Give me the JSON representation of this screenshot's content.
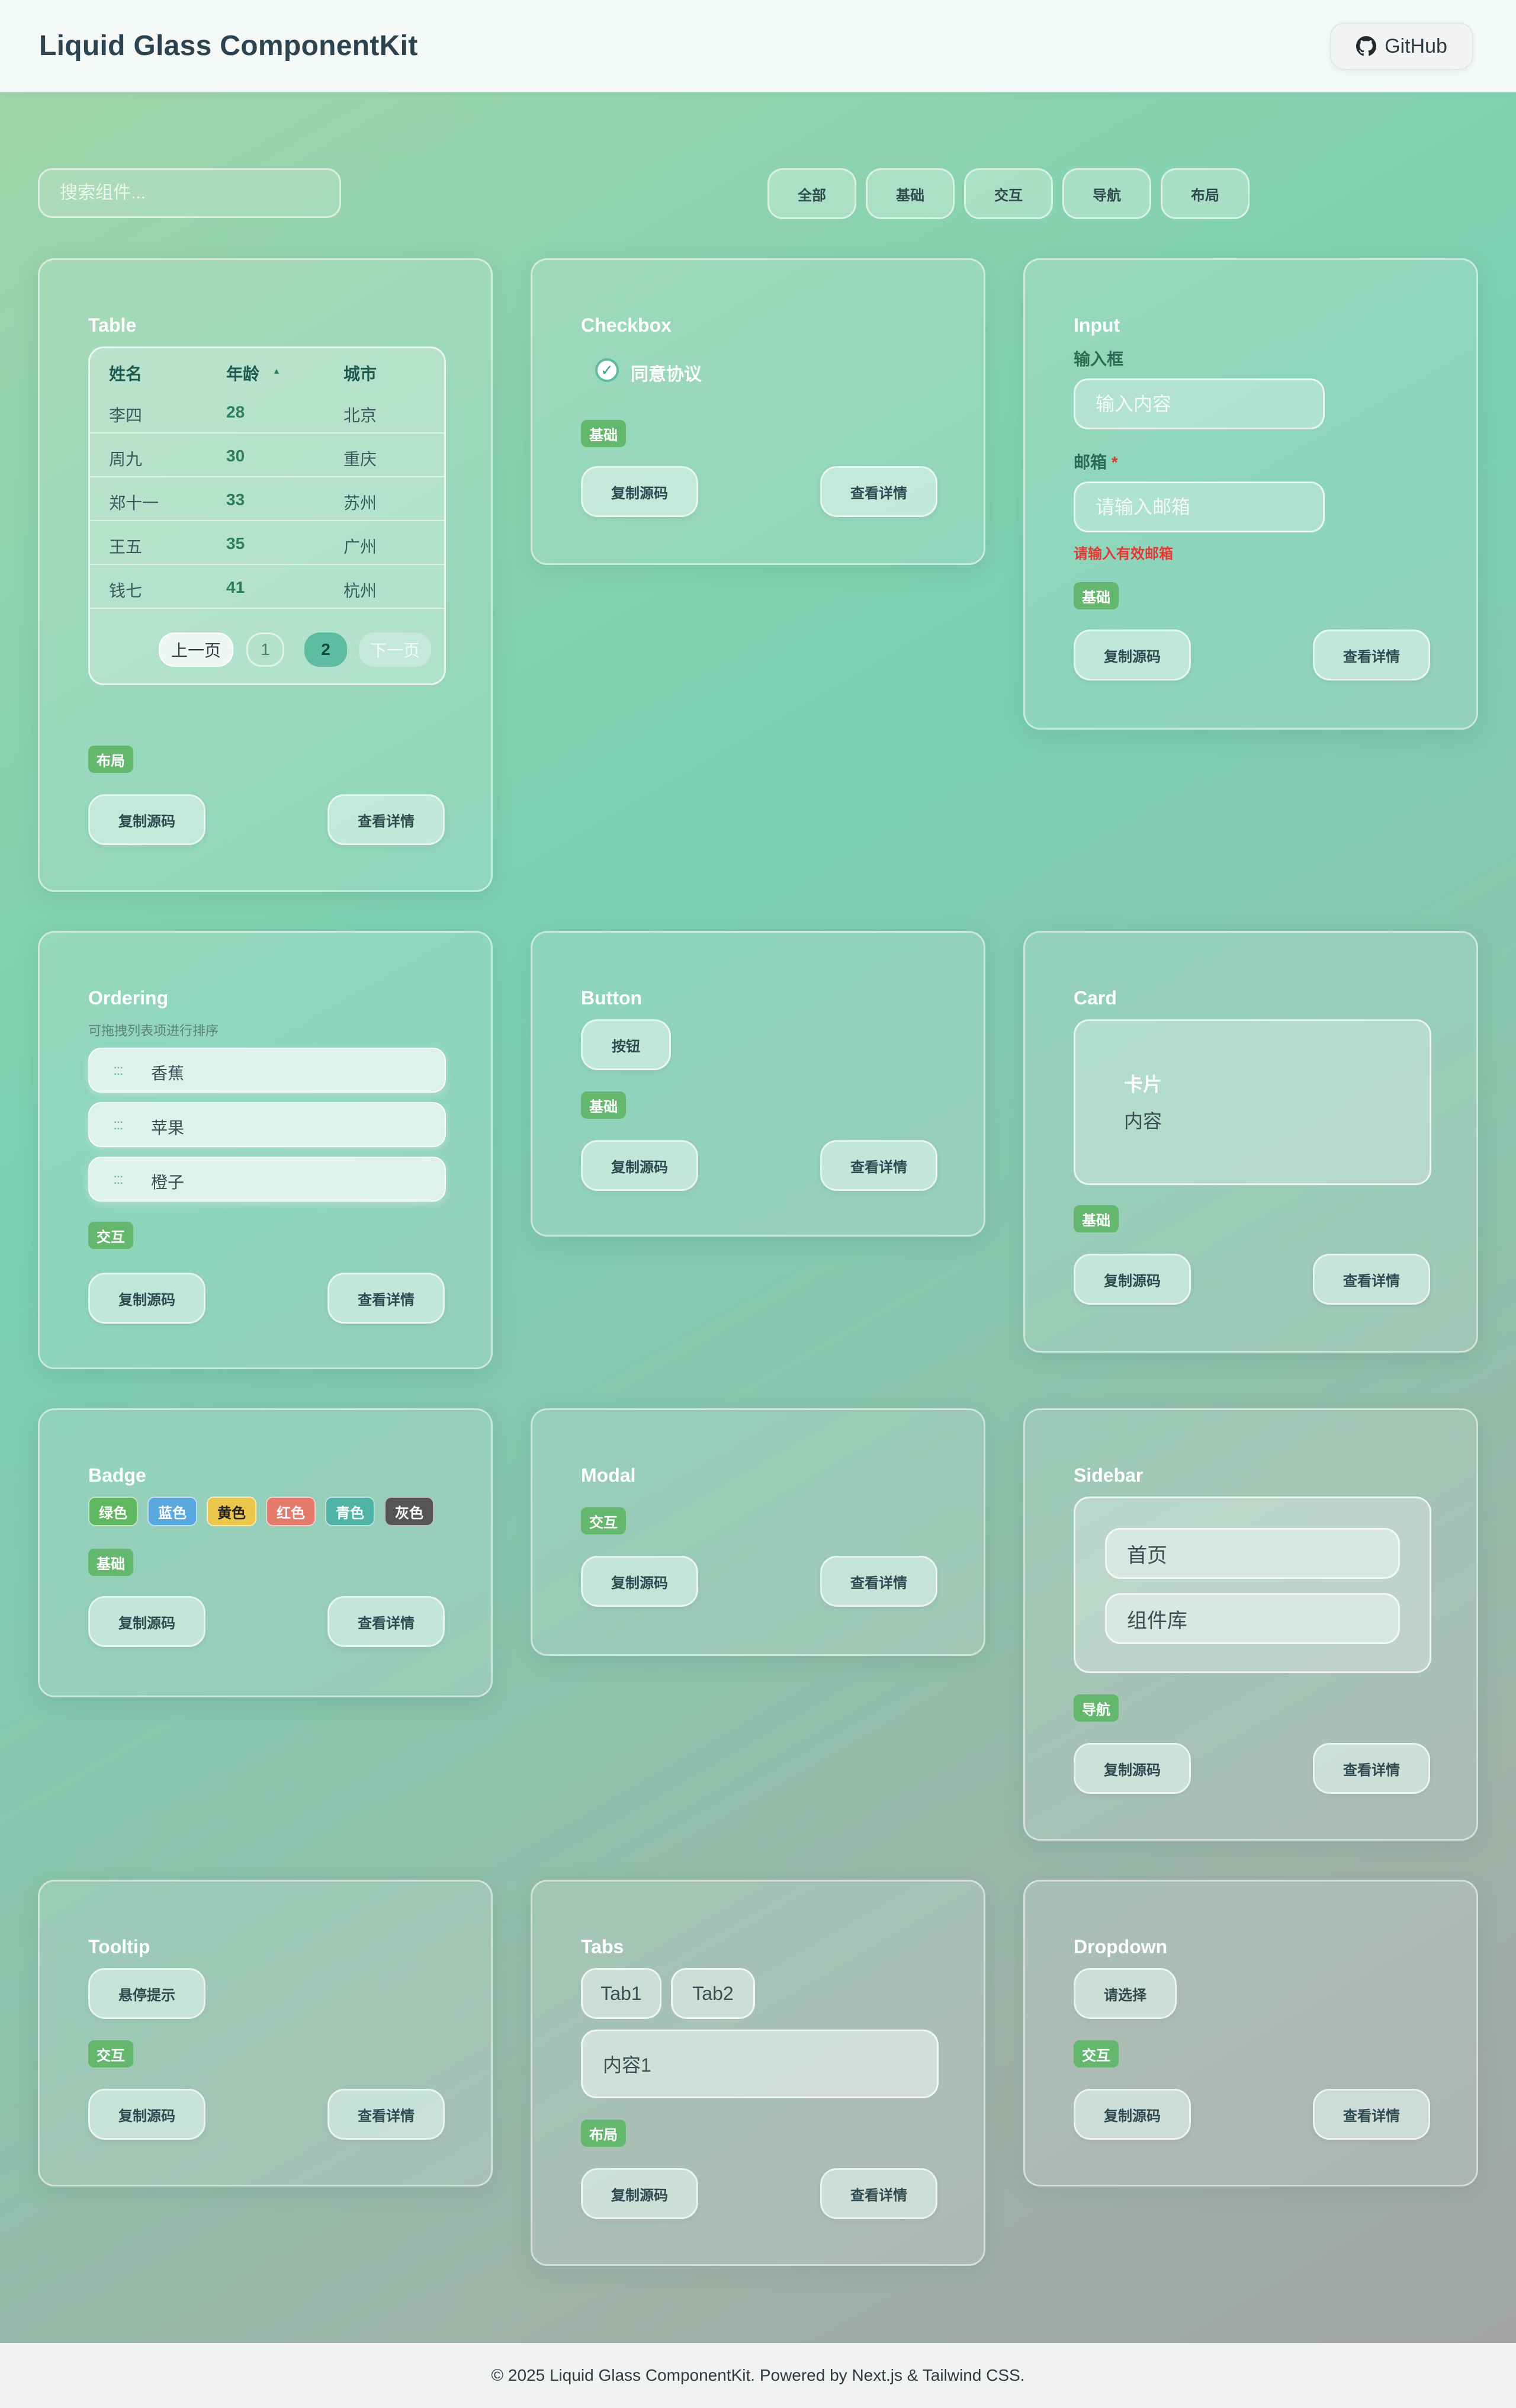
{
  "header": {
    "title": "Liquid Glass ComponentKit",
    "github_label": "GitHub",
    "github_icon": "github-icon"
  },
  "search": {
    "placeholder": "搜索组件..."
  },
  "filters": [
    "全部",
    "基础",
    "交互",
    "导航",
    "布局"
  ],
  "actions": {
    "copy": "复制源码",
    "detail": "查看详情"
  },
  "colors": {
    "tag_green": "#64b86d",
    "error_red": "#e53935",
    "page_active": "#5ebda0"
  },
  "cards": {
    "table": {
      "title": "Table",
      "tag": "布局",
      "columns": [
        "姓名",
        "年龄",
        "城市"
      ],
      "sort_icon": "sort-asc-icon",
      "rows": [
        {
          "name": "李四",
          "age": "28",
          "city": "北京"
        },
        {
          "name": "周九",
          "age": "30",
          "city": "重庆"
        },
        {
          "name": "郑十一",
          "age": "33",
          "city": "苏州"
        },
        {
          "name": "王五",
          "age": "35",
          "city": "广州"
        },
        {
          "name": "钱七",
          "age": "41",
          "city": "杭州"
        }
      ],
      "pagination": {
        "prev": "上一页",
        "pages": [
          "1",
          "2"
        ],
        "current": "2",
        "next": "下一页"
      }
    },
    "checkbox": {
      "title": "Checkbox",
      "label": "同意协议",
      "checked": true,
      "tag": "基础"
    },
    "input": {
      "title": "Input",
      "tag": "基础",
      "field1_label": "输入框",
      "field1_placeholder": "输入内容",
      "field2_label": "邮箱",
      "required_mark": "*",
      "field2_placeholder": "请输入邮箱",
      "error": "请输入有效邮箱"
    },
    "ordering": {
      "title": "Ordering",
      "hint": "可拖拽列表项进行排序",
      "handle": ":::",
      "items": [
        "香蕉",
        "苹果",
        "橙子"
      ],
      "tag": "交互"
    },
    "button": {
      "title": "Button",
      "demo": "按钮",
      "tag": "基础"
    },
    "card": {
      "title": "Card",
      "inner_title": "卡片",
      "inner_body": "内容",
      "tag": "基础"
    },
    "badge": {
      "title": "Badge",
      "tag": "基础",
      "badges": [
        {
          "label": "绿色",
          "color": "#5fb85f"
        },
        {
          "label": "蓝色",
          "color": "#5aa8e0"
        },
        {
          "label": "黄色",
          "color": "#ecc64a"
        },
        {
          "label": "红色",
          "color": "#e47a6a"
        },
        {
          "label": "青色",
          "color": "#4fb3a5"
        },
        {
          "label": "灰色",
          "color": "#555555"
        }
      ]
    },
    "modal": {
      "title": "Modal",
      "tag": "交互"
    },
    "sidebar": {
      "title": "Sidebar",
      "items": [
        "首页",
        "组件库"
      ],
      "tag": "导航"
    },
    "tooltip": {
      "title": "Tooltip",
      "demo": "悬停提示",
      "tag": "交互"
    },
    "tabs": {
      "title": "Tabs",
      "tabs": [
        "Tab1",
        "Tab2"
      ],
      "content": "内容1",
      "tag": "布局"
    },
    "dropdown": {
      "title": "Dropdown",
      "selected": "请选择",
      "tag": "交互"
    }
  },
  "footer": {
    "text": "© 2025 Liquid Glass ComponentKit. Powered by Next.js & Tailwind CSS."
  }
}
